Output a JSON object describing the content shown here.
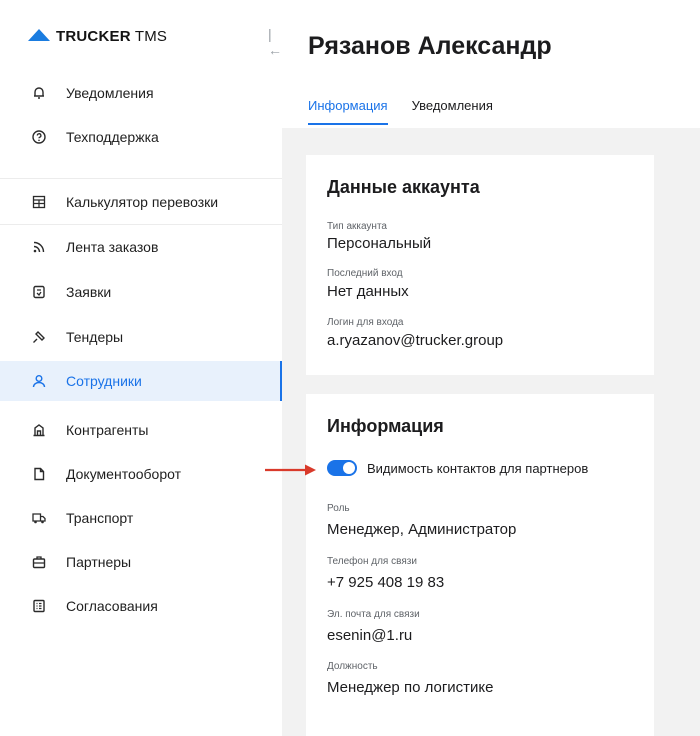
{
  "brand": {
    "name_bold": "TRUCKER",
    "name_thin": " TMS",
    "accent": "#1a73e8"
  },
  "sidebar": {
    "collapse_glyph": "|←",
    "items": [
      {
        "label": "Уведомления",
        "icon": "bell-icon"
      },
      {
        "label": "Техподдержка",
        "icon": "help-circle-icon"
      },
      {
        "label": "Калькулятор перевозки",
        "icon": "calculator-icon"
      },
      {
        "label": "Лента заказов",
        "icon": "rss-feed-icon"
      },
      {
        "label": "Заявки",
        "icon": "document-icon"
      },
      {
        "label": "Тендеры",
        "icon": "gavel-icon"
      },
      {
        "label": "Сотрудники",
        "icon": "user-icon",
        "active": true
      },
      {
        "label": "Контрагенты",
        "icon": "building-icon"
      },
      {
        "label": "Документооборот",
        "icon": "file-icon"
      },
      {
        "label": "Транспорт",
        "icon": "truck-icon"
      },
      {
        "label": "Партнеры",
        "icon": "briefcase-icon"
      },
      {
        "label": "Согласования",
        "icon": "checklist-icon"
      }
    ]
  },
  "page": {
    "title": "Рязанов Александр",
    "tabs": [
      {
        "label": "Информация",
        "active": true
      },
      {
        "label": "Уведомления",
        "active": false
      }
    ]
  },
  "account_card": {
    "title": "Данные аккаунта",
    "fields": [
      {
        "label": "Тип аккаунта",
        "value": "Персональный"
      },
      {
        "label": "Последний вход",
        "value": "Нет данных"
      },
      {
        "label": "Логин для входа",
        "value": "a.ryazanov@trucker.group"
      }
    ]
  },
  "info_card": {
    "title": "Информация",
    "toggle": {
      "label": "Видимость контактов для партнеров",
      "on": true
    },
    "fields": [
      {
        "label": "Роль",
        "value": "Менеджер, Администратор"
      },
      {
        "label": "Телефон для связи",
        "value": "+7 925 408 19 83"
      },
      {
        "label": "Эл. почта для связи",
        "value": "esenin@1.ru"
      },
      {
        "label": "Должность",
        "value": "Менеджер по логистике"
      }
    ]
  },
  "annotation": {
    "color": "#d93a2b"
  }
}
